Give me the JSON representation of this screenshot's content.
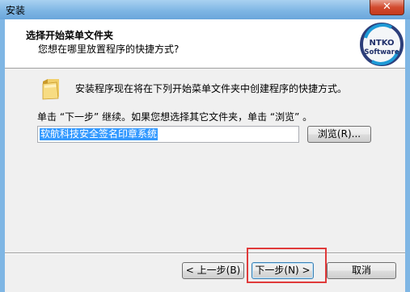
{
  "window": {
    "title": "安装",
    "close_symbol": "✕"
  },
  "header": {
    "title": "选择开始菜单文件夹",
    "subtitle": "您想在哪里放置程序的快捷方式?",
    "logo_text_top": "NTKO",
    "logo_text_bottom": "Software"
  },
  "body": {
    "info_line": "安装程序现在将在下列开始菜单文件夹中创建程序的快捷方式。",
    "instruction": "单击 “下一步” 继续。如果您想选择其它文件夹，单击 “浏览” 。",
    "folder_path": "软航科技安全签名印章系统",
    "browse_label": "浏览(R)..."
  },
  "buttons": {
    "back_label": "< 上一步(B)",
    "next_label": "下一步(N) >",
    "cancel_label": "取消"
  },
  "colors": {
    "highlight": "#e03a3a",
    "selection": "#3399ff"
  },
  "icons": {
    "folder": "folder-icon",
    "logo": "ntko-logo-icon"
  }
}
